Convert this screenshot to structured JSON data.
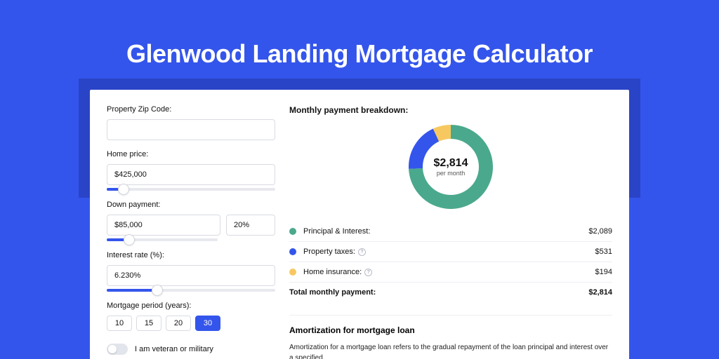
{
  "title": "Glenwood Landing Mortgage Calculator",
  "form": {
    "zip_label": "Property Zip Code:",
    "zip_value": "",
    "home_price_label": "Home price:",
    "home_price_value": "$425,000",
    "home_price_slider_pct": 10,
    "down_payment_label": "Down payment:",
    "down_payment_amount": "$85,000",
    "down_payment_pct": "20%",
    "down_payment_slider_pct": 20,
    "interest_label": "Interest rate (%):",
    "interest_value": "6.230%",
    "interest_slider_pct": 30,
    "period_label": "Mortgage period (years):",
    "periods": [
      {
        "label": "10",
        "active": false
      },
      {
        "label": "15",
        "active": false
      },
      {
        "label": "20",
        "active": false
      },
      {
        "label": "30",
        "active": true
      }
    ],
    "veteran_label": "I am veteran or military",
    "veteran_on": false
  },
  "breakdown": {
    "title": "Monthly payment breakdown:",
    "center_amount": "$2,814",
    "center_sub": "per month",
    "items": [
      {
        "label": "Principal & Interest:",
        "value": "$2,089",
        "color": "#4aa98c",
        "info": false
      },
      {
        "label": "Property taxes:",
        "value": "$531",
        "color": "#3455eb",
        "info": true
      },
      {
        "label": "Home insurance:",
        "value": "$194",
        "color": "#f6c85f",
        "info": true
      }
    ],
    "total_label": "Total monthly payment:",
    "total_value": "$2,814"
  },
  "chart_data": {
    "type": "pie",
    "title": "Monthly payment breakdown",
    "series": [
      {
        "name": "Principal & Interest",
        "value": 2089,
        "color": "#4aa98c"
      },
      {
        "name": "Property taxes",
        "value": 531,
        "color": "#3455eb"
      },
      {
        "name": "Home insurance",
        "value": 194,
        "color": "#f6c85f"
      }
    ],
    "total": 2814,
    "unit": "USD per month"
  },
  "amort": {
    "title": "Amortization for mortgage loan",
    "text": "Amortization for a mortgage loan refers to the gradual repayment of the loan principal and interest over a specified"
  }
}
